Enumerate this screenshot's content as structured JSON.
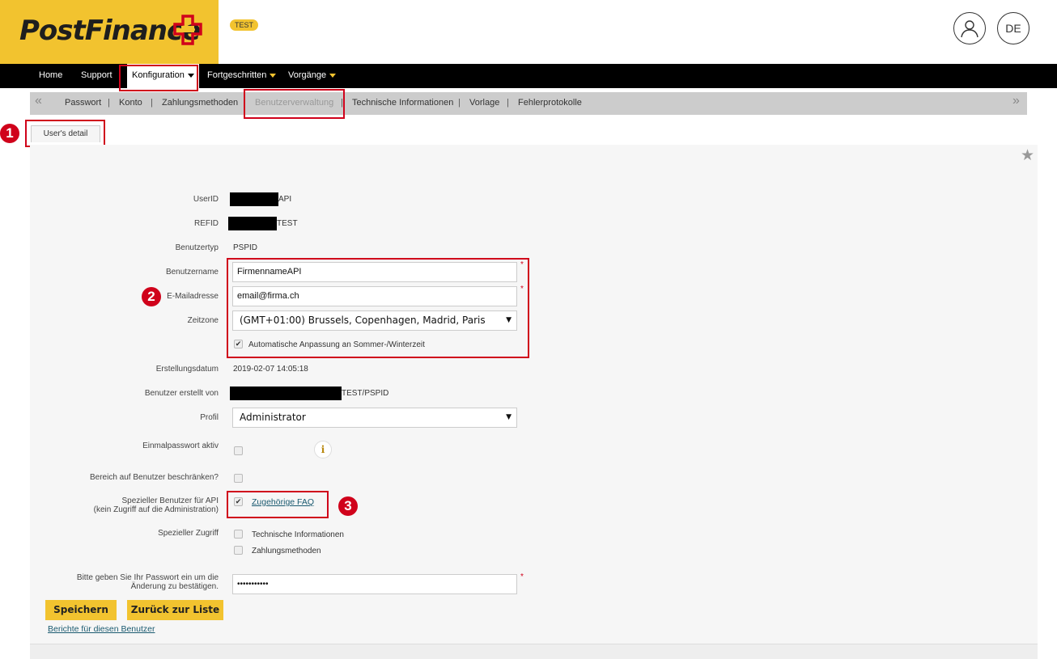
{
  "header": {
    "logo_text": "PostFinance",
    "env_badge": "TEST",
    "lang": "DE"
  },
  "main_nav": {
    "items": [
      {
        "label": "Home"
      },
      {
        "label": "Support"
      },
      {
        "label": "Konfiguration"
      },
      {
        "label": "Fortgeschritten"
      },
      {
        "label": "Vorgänge"
      }
    ]
  },
  "sub_nav": {
    "items": [
      {
        "label": "Passwort"
      },
      {
        "label": "Konto"
      },
      {
        "label": "Zahlungsmethoden"
      },
      {
        "label": "Benutzerverwaltung"
      },
      {
        "label": "Technische Informationen"
      },
      {
        "label": "Vorlage"
      },
      {
        "label": "Fehlerprotokolle"
      }
    ],
    "separator": "|"
  },
  "tab": {
    "label": "User's detail"
  },
  "badges": {
    "one": "1",
    "two": "2",
    "three": "3"
  },
  "form": {
    "userid": {
      "label": "UserID",
      "value": "API"
    },
    "refid": {
      "label": "REFID",
      "value": "TEST"
    },
    "benutzertyp": {
      "label": "Benutzertyp",
      "value": "PSPID"
    },
    "benutzername": {
      "label": "Benutzername",
      "value": "FirmennameAPI"
    },
    "email": {
      "label": "E-Mailadresse",
      "value": "email@firma.ch"
    },
    "zeitzone": {
      "label": "Zeitzone",
      "value": "(GMT+01:00) Brussels, Copenhagen, Madrid, Paris"
    },
    "auto_dst": {
      "label": "Automatische Anpassung an Sommer-/Winterzeit",
      "checked": true
    },
    "erstellungsdatum": {
      "label": "Erstellungsdatum",
      "value": "2019-02-07 14:05:18"
    },
    "erstellt_von": {
      "label": "Benutzer erstellt von",
      "value": "TEST/PSPID"
    },
    "profil": {
      "label": "Profil",
      "value": "Administrator"
    },
    "einmalpasswort": {
      "label": "Einmalpasswort aktiv",
      "checked": false
    },
    "bereich": {
      "label": "Bereich auf Benutzer beschränken?",
      "checked": false
    },
    "api_user": {
      "label_line1": "Spezieller Benutzer für API",
      "label_line2": "(kein Zugriff auf die Administration)",
      "checked": true,
      "link": "Zugehörige FAQ"
    },
    "spezieller_zugriff": {
      "label": "Spezieller Zugriff",
      "options": [
        {
          "label": "Technische Informationen",
          "checked": false
        },
        {
          "label": "Zahlungsmethoden",
          "checked": false
        }
      ]
    },
    "passwort": {
      "label_line1": "Bitte geben Sie Ihr Passwort ein um die",
      "label_line2": "Änderung zu bestätigen.",
      "value": "•••••••••••"
    },
    "required_mark": "*"
  },
  "actions": {
    "save": "Speichern",
    "back": "Zurück zur Liste",
    "reports_link": "Berichte für diesen Benutzer"
  },
  "colors": {
    "brand_yellow": "#f2c32f",
    "highlight_red": "#d0021b",
    "nav_black": "#000000"
  }
}
